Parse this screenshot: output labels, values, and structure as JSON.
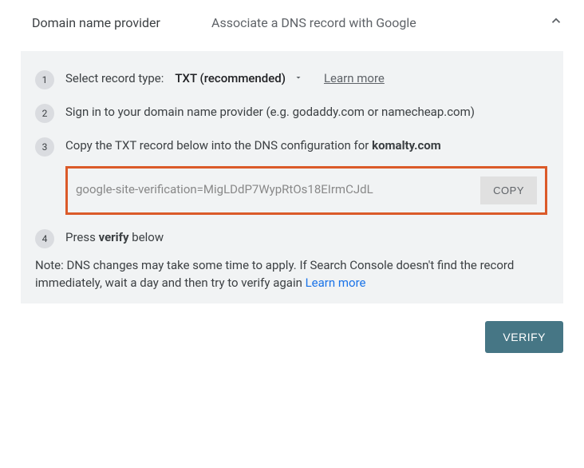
{
  "header": {
    "title": "Domain name provider",
    "subtitle": "Associate a DNS record with Google"
  },
  "steps": {
    "s1": {
      "num": "1",
      "label": "Select record type:",
      "select_value": "TXT (recommended)",
      "learn_more": "Learn more"
    },
    "s2": {
      "num": "2",
      "text": "Sign in to your domain name provider (e.g. godaddy.com or namecheap.com)"
    },
    "s3": {
      "num": "3",
      "prefix": "Copy the TXT record below into the DNS configuration for ",
      "domain": "komalty.com",
      "txt_record": "google-site-verification=MigLDdP7WypRtOs18EIrmCJdL",
      "copy": "COPY"
    },
    "s4": {
      "num": "4",
      "prefix": "Press ",
      "bold": "verify",
      "suffix": " below"
    }
  },
  "note": {
    "text": "Note: DNS changes may take some time to apply. If Search Console doesn't find the record immediately, wait a day and then try to verify again ",
    "link": "Learn more"
  },
  "footer": {
    "verify": "VERIFY"
  }
}
